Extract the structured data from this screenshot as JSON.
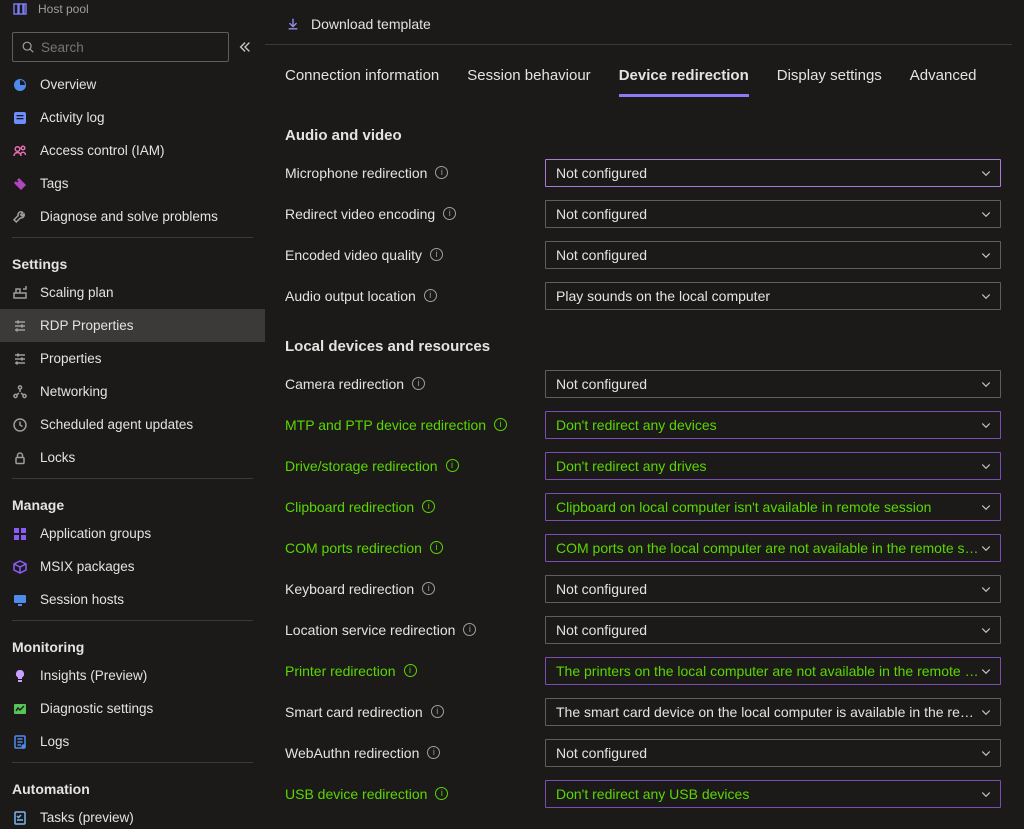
{
  "header": {
    "resource_type": "Host pool"
  },
  "search": {
    "placeholder": "Search"
  },
  "sidebar": {
    "top": [
      {
        "label": "Overview",
        "icon": "overview",
        "color": "#4f8bed"
      },
      {
        "label": "Activity log",
        "icon": "activity",
        "color": "#6c8eff"
      },
      {
        "label": "Access control (IAM)",
        "icon": "iam",
        "color": "#e86db2"
      },
      {
        "label": "Tags",
        "icon": "tags",
        "color": "#b146c2"
      },
      {
        "label": "Diagnose and solve problems",
        "icon": "wrench",
        "color": "#a0a0a0"
      }
    ],
    "sections": [
      {
        "title": "Settings",
        "items": [
          {
            "label": "Scaling plan",
            "icon": "scale"
          },
          {
            "label": "RDP Properties",
            "icon": "sliders",
            "selected": true
          },
          {
            "label": "Properties",
            "icon": "sliders"
          },
          {
            "label": "Networking",
            "icon": "network"
          },
          {
            "label": "Scheduled agent updates",
            "icon": "clock"
          },
          {
            "label": "Locks",
            "icon": "lock"
          }
        ]
      },
      {
        "title": "Manage",
        "items": [
          {
            "label": "Application groups",
            "icon": "apps",
            "color": "#8a5cf6"
          },
          {
            "label": "MSIX packages",
            "icon": "package",
            "color": "#8a5cf6"
          },
          {
            "label": "Session hosts",
            "icon": "monitor",
            "color": "#4f8bed"
          }
        ]
      },
      {
        "title": "Monitoring",
        "items": [
          {
            "label": "Insights (Preview)",
            "icon": "bulb",
            "color": "#c9a0ff"
          },
          {
            "label": "Diagnostic settings",
            "icon": "diag",
            "color": "#57c457"
          },
          {
            "label": "Logs",
            "icon": "logs",
            "color": "#4f8bed"
          }
        ]
      },
      {
        "title": "Automation",
        "items": [
          {
            "label": "Tasks (preview)",
            "icon": "tasks",
            "color": "#7ab8f0"
          }
        ]
      }
    ]
  },
  "toolbar": {
    "download_template": "Download template"
  },
  "tabs": [
    {
      "label": "Connection information",
      "active": false
    },
    {
      "label": "Session behaviour",
      "active": false
    },
    {
      "label": "Device redirection",
      "active": true
    },
    {
      "label": "Display settings",
      "active": false
    },
    {
      "label": "Advanced",
      "active": false
    }
  ],
  "form": [
    {
      "type": "section",
      "title": "Audio and video"
    },
    {
      "type": "row",
      "label": "Microphone redirection",
      "value": "Not configured",
      "focused": true
    },
    {
      "type": "row",
      "label": "Redirect video encoding",
      "value": "Not configured"
    },
    {
      "type": "row",
      "label": "Encoded video quality",
      "value": "Not configured"
    },
    {
      "type": "row",
      "label": "Audio output location",
      "value": "Play sounds on the local computer"
    },
    {
      "type": "section",
      "title": "Local devices and resources"
    },
    {
      "type": "row",
      "label": "Camera redirection",
      "value": "Not configured"
    },
    {
      "type": "row",
      "label": "MTP and PTP device redirection",
      "value": "Don't redirect any devices",
      "highlight": true,
      "purple": true
    },
    {
      "type": "row",
      "label": "Drive/storage redirection",
      "value": "Don't redirect any drives",
      "highlight": true,
      "purple": true
    },
    {
      "type": "row",
      "label": "Clipboard redirection",
      "value": "Clipboard on local computer isn't available in remote session",
      "highlight": true,
      "purple": true
    },
    {
      "type": "row",
      "label": "COM ports redirection",
      "value": "COM ports on the local computer are not available in the remote se…",
      "highlight": true,
      "purple": true
    },
    {
      "type": "row",
      "label": "Keyboard redirection",
      "value": "Not configured"
    },
    {
      "type": "row",
      "label": "Location service redirection",
      "value": "Not configured"
    },
    {
      "type": "row",
      "label": "Printer redirection",
      "value": "The printers on the local computer are not available in the remote s…",
      "highlight": true,
      "purple": true
    },
    {
      "type": "row",
      "label": "Smart card redirection",
      "value": "The smart card device on the local computer is available in the remo…"
    },
    {
      "type": "row",
      "label": "WebAuthn redirection",
      "value": "Not configured"
    },
    {
      "type": "row",
      "label": "USB device redirection",
      "value": "Don't redirect any USB devices",
      "highlight": true,
      "purple": true
    }
  ]
}
